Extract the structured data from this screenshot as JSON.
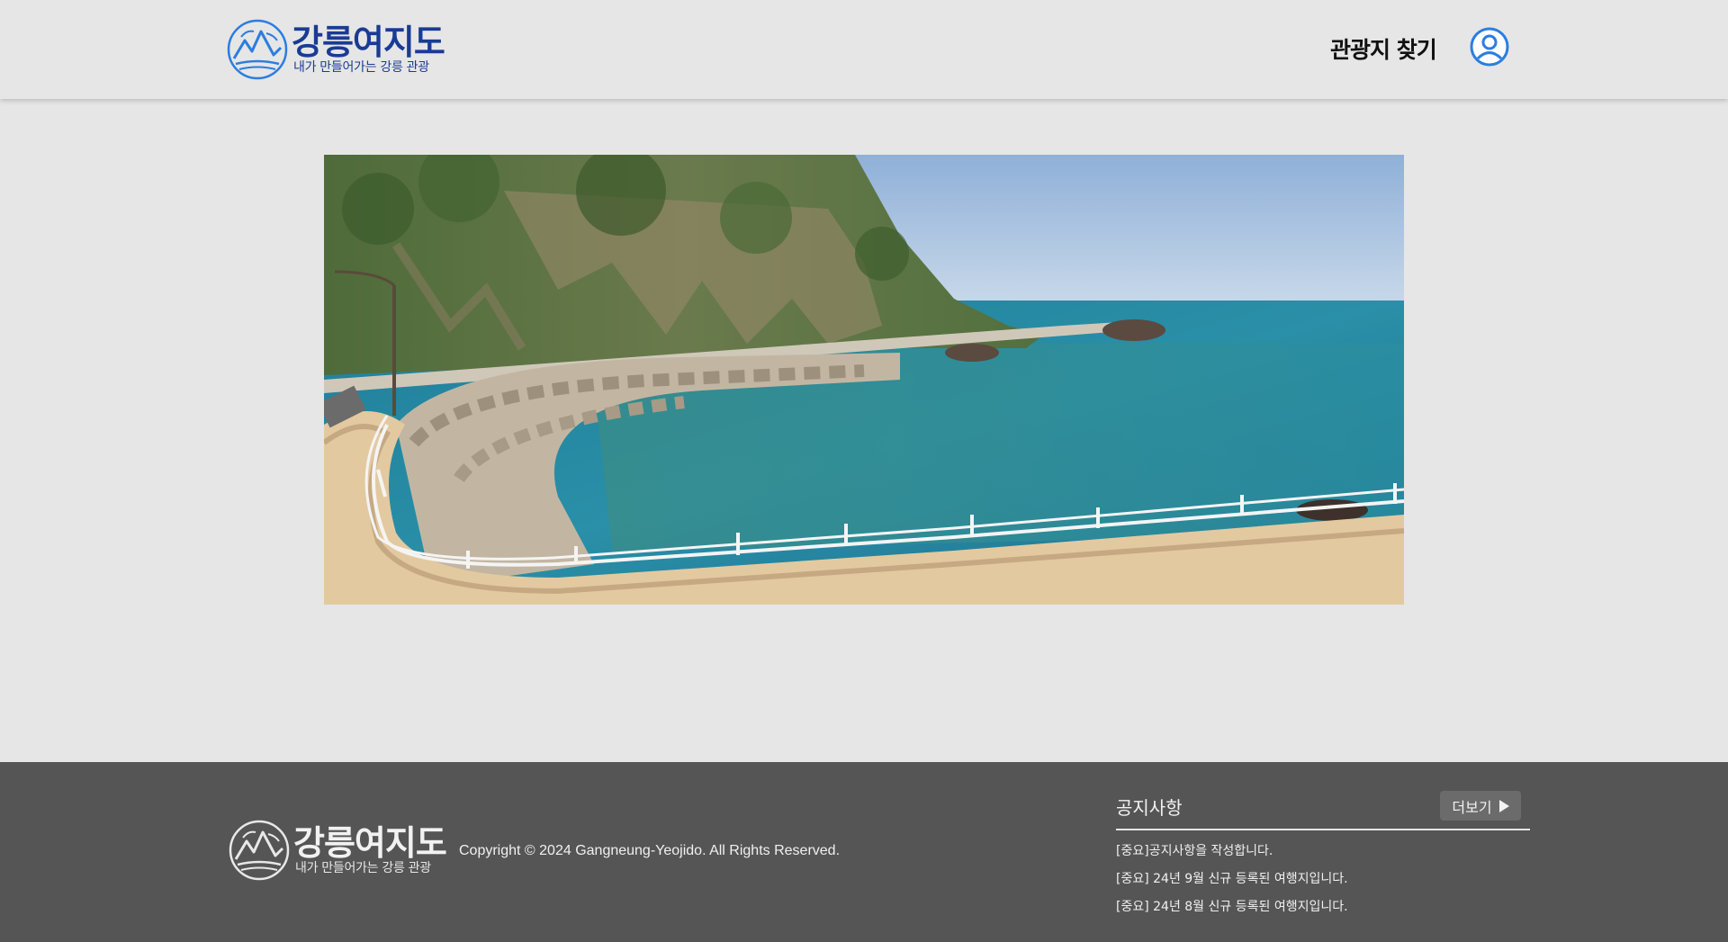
{
  "header": {
    "logo_title": "강릉여지도",
    "logo_subtitle": "내가 만들어가는 강릉 관광",
    "nav_find": "관광지 찾기",
    "user_icon": "user-circle-icon",
    "brand_color": "#1a3b95",
    "accent_color": "#2b7de0"
  },
  "hero": {
    "image": "coastal-road-sea-photo"
  },
  "footer": {
    "logo_title": "강릉여지도",
    "logo_subtitle": "내가 만들어가는 강릉 관광",
    "copyright": "Copyright © 2024 Gangneung-Yeojido. All Rights Reserved.",
    "notice_title": "공지사항",
    "more_label": "더보기",
    "notices": [
      "[중요]공지사항을 작성합니다.",
      "[중요] 24년 9월 신규 등록된 여행지입니다.",
      "[중요] 24년 8월 신규 등록된 여행지입니다."
    ],
    "background": "#555555"
  }
}
